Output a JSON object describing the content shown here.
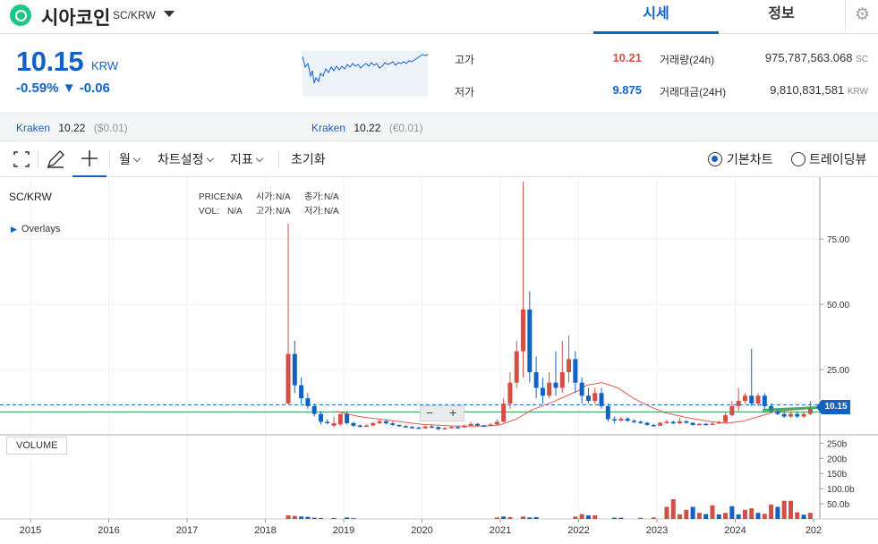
{
  "header": {
    "coin_name": "시아코인",
    "coin_pair": "SC/KRW",
    "tabs": [
      {
        "label": "시세"
      },
      {
        "label": "정보"
      }
    ]
  },
  "price": {
    "current": "10.15",
    "unit": "KRW",
    "change": "-0.59% ▼ -0.06"
  },
  "stats": {
    "high_label": "고가",
    "high_value": "10.21",
    "low_label": "저가",
    "low_value": "9.875",
    "volume_label": "거래량(24h)",
    "volume_value": "975,787,563.068",
    "volume_unit": "SC",
    "amount_label": "거래대금(24H)",
    "amount_value": "9,810,831,581",
    "amount_unit": "KRW"
  },
  "exchanges": [
    {
      "name": "Kraken",
      "price": "10.22",
      "diff": "($0.01)"
    },
    {
      "name": "Kraken",
      "price": "10.22",
      "diff": "(€0.01)"
    }
  ],
  "toolbar": {
    "period": "월",
    "chart_settings": "차트설정",
    "indicators": "지표",
    "reset": "초기화",
    "basic_chart": "기본차트",
    "trading_view": "트레이딩뷰"
  },
  "chart": {
    "pair": "SC/KRW",
    "legend": [
      [
        "PRICE:",
        "N/A",
        "시가:",
        "N/A",
        "종가:",
        "N/A"
      ],
      [
        "VOL:",
        "N/A",
        "고가:",
        "N/A",
        "저가:",
        "N/A"
      ]
    ],
    "overlays": "Overlays",
    "volume_label": "VOLUME",
    "price_tag": "10.15",
    "zoom_minus": "−",
    "zoom_plus": "+"
  },
  "colors": {
    "accent": "#1261c4",
    "up": "#d24f45",
    "down": "#1261c4",
    "ma": "#e05a4f",
    "green_line": "#2e9c52"
  },
  "chart_data": {
    "type": "candlestick",
    "title": "SC/KRW",
    "xlabels": [
      "2015",
      "2016",
      "2017",
      "2018",
      "2019",
      "2020",
      "2021",
      "2022",
      "2023",
      "2024",
      "202"
    ],
    "ylabels": [
      "75.00",
      "50.00",
      "25.00"
    ],
    "vol_ylabels": [
      "250b",
      "200b",
      "150b",
      "100.0b",
      "50.0b"
    ],
    "ylim": [
      0,
      97
    ],
    "last_price": 10.15,
    "candles": [
      [
        "2018-04",
        12,
        31,
        12,
        81,
        "up"
      ],
      [
        "2018-05",
        31,
        19,
        16,
        36,
        "down"
      ],
      [
        "2018-06",
        19,
        14,
        12,
        22,
        "down"
      ],
      [
        "2018-07",
        14,
        11,
        10,
        16,
        "down"
      ],
      [
        "2018-08",
        11,
        8,
        7,
        12,
        "down"
      ],
      [
        "2018-09",
        8,
        5,
        4,
        9,
        "down"
      ],
      [
        "2018-10",
        5,
        4.5,
        4,
        6,
        "down"
      ],
      [
        "2018-11",
        4.5,
        3.5,
        3,
        7,
        "up"
      ],
      [
        "2018-12",
        4,
        8,
        3.5,
        8,
        "up"
      ],
      [
        "2019-01",
        8,
        4.5,
        4,
        9,
        "down"
      ],
      [
        "2019-02",
        4.5,
        3.5,
        3,
        5,
        "down"
      ],
      [
        "2019-03",
        3.6,
        3.2,
        2.8,
        4,
        "down"
      ],
      [
        "2019-04",
        3.2,
        3.6,
        3,
        4,
        "up"
      ],
      [
        "2019-05",
        3.6,
        4.5,
        3.2,
        5,
        "up"
      ],
      [
        "2019-06",
        4.5,
        5.2,
        4,
        6,
        "up"
      ],
      [
        "2019-07",
        5.2,
        4.4,
        4,
        6,
        "down"
      ],
      [
        "2019-08",
        4.4,
        3.8,
        3.5,
        5,
        "down"
      ],
      [
        "2019-09",
        3.8,
        3.3,
        3,
        4,
        "down"
      ],
      [
        "2019-10",
        3.3,
        3.0,
        2.8,
        3.8,
        "down"
      ],
      [
        "2019-11",
        3.0,
        2.8,
        2.5,
        3.4,
        "down"
      ],
      [
        "2019-12",
        2.8,
        2.5,
        2.3,
        3.2,
        "down"
      ],
      [
        "2020-01",
        2.5,
        3.2,
        2.4,
        3.5,
        "up"
      ],
      [
        "2020-02",
        3.2,
        3.0,
        2.8,
        3.8,
        "down"
      ],
      [
        "2020-03",
        3.0,
        2.2,
        1.8,
        3.2,
        "down"
      ],
      [
        "2020-04",
        2.2,
        2.6,
        2,
        3,
        "up"
      ],
      [
        "2020-05",
        2.6,
        3.0,
        2.5,
        3.5,
        "up"
      ],
      [
        "2020-06",
        3.0,
        2.8,
        2.6,
        3.4,
        "down"
      ],
      [
        "2020-07",
        2.8,
        3.4,
        2.7,
        4,
        "up"
      ],
      [
        "2020-08",
        3.4,
        4.2,
        3.2,
        5,
        "up"
      ],
      [
        "2020-09",
        4.2,
        3.6,
        3.2,
        4.5,
        "down"
      ],
      [
        "2020-10",
        3.6,
        3.4,
        3.2,
        3.9,
        "down"
      ],
      [
        "2020-11",
        3.4,
        4.0,
        3.2,
        4.5,
        "up"
      ],
      [
        "2020-12",
        4.0,
        5.0,
        3.8,
        6,
        "up"
      ],
      [
        "2021-01",
        5,
        12,
        4.8,
        14,
        "up"
      ],
      [
        "2021-02",
        12,
        20,
        10,
        24,
        "up"
      ],
      [
        "2021-03",
        20,
        32,
        18,
        36,
        "up"
      ],
      [
        "2021-04",
        32,
        48,
        22,
        97,
        "up"
      ],
      [
        "2021-05",
        48,
        24,
        20,
        55,
        "down"
      ],
      [
        "2021-06",
        24,
        18,
        14,
        30,
        "down"
      ],
      [
        "2021-07",
        18,
        15,
        12,
        22,
        "down"
      ],
      [
        "2021-08",
        15,
        20,
        14,
        24,
        "up"
      ],
      [
        "2021-09",
        20,
        18,
        15,
        32,
        "down"
      ],
      [
        "2021-10",
        18,
        24,
        16,
        36,
        "up"
      ],
      [
        "2021-11",
        24,
        29,
        20,
        38,
        "up"
      ],
      [
        "2021-12",
        29,
        20,
        16,
        32,
        "down"
      ],
      [
        "2022-01",
        20,
        15,
        12,
        22,
        "down"
      ],
      [
        "2022-02",
        15,
        13,
        12,
        18,
        "down"
      ],
      [
        "2022-03",
        13,
        16,
        12,
        18,
        "up"
      ],
      [
        "2022-04",
        16,
        11,
        10,
        18,
        "down"
      ],
      [
        "2022-05",
        11,
        6,
        5,
        12,
        "down"
      ],
      [
        "2022-06",
        6,
        5.5,
        4.5,
        7,
        "down"
      ],
      [
        "2022-07",
        5.5,
        6.2,
        5,
        7,
        "up"
      ],
      [
        "2022-08",
        6.2,
        5.4,
        5,
        6.8,
        "down"
      ],
      [
        "2022-09",
        5.4,
        5.0,
        4.5,
        6,
        "down"
      ],
      [
        "2022-10",
        5.0,
        4.6,
        4.2,
        5.5,
        "down"
      ],
      [
        "2022-11",
        4.6,
        3.8,
        3.5,
        5,
        "down"
      ],
      [
        "2022-12",
        3.8,
        3.5,
        3.2,
        4.2,
        "down"
      ],
      [
        "2023-01",
        3.5,
        4.6,
        3.4,
        5,
        "up"
      ],
      [
        "2023-02",
        4.6,
        5.0,
        4.2,
        5.8,
        "up"
      ],
      [
        "2023-03",
        5.0,
        4.4,
        4,
        5.4,
        "down"
      ],
      [
        "2023-04",
        4.4,
        5.2,
        4.2,
        6.5,
        "up"
      ],
      [
        "2023-05",
        5.2,
        4.6,
        4.3,
        5.6,
        "down"
      ],
      [
        "2023-06",
        4.6,
        3.8,
        3.5,
        4.8,
        "down"
      ],
      [
        "2023-07",
        3.8,
        4.2,
        3.6,
        4.5,
        "up"
      ],
      [
        "2023-08",
        4.2,
        3.9,
        3.7,
        4.6,
        "down"
      ],
      [
        "2023-09",
        3.9,
        4.3,
        3.8,
        4.8,
        "up"
      ],
      [
        "2023-10",
        4.3,
        4.9,
        4.2,
        5.4,
        "up"
      ],
      [
        "2023-11",
        4.9,
        7.5,
        4.8,
        8.5,
        "up"
      ],
      [
        "2023-12",
        7.5,
        11,
        7,
        13,
        "up"
      ],
      [
        "2024-01",
        11,
        13,
        9,
        18,
        "up"
      ],
      [
        "2024-02",
        13,
        15,
        12,
        16,
        "up"
      ],
      [
        "2024-03",
        15,
        12,
        11,
        33,
        "down"
      ],
      [
        "2024-04",
        12,
        15,
        11,
        16,
        "up"
      ],
      [
        "2024-05",
        15,
        11,
        10,
        16,
        "down"
      ],
      [
        "2024-06",
        11,
        9,
        8.5,
        12,
        "down"
      ],
      [
        "2024-07",
        9,
        8,
        7.5,
        10,
        "down"
      ],
      [
        "2024-08",
        8,
        7,
        6.5,
        9,
        "down"
      ],
      [
        "2024-09",
        7,
        8,
        6.5,
        9,
        "up"
      ],
      [
        "2024-10",
        8,
        7,
        6.5,
        9,
        "down"
      ],
      [
        "2024-11",
        7,
        8,
        6.5,
        9,
        "up"
      ],
      [
        "2024-12",
        8,
        10.15,
        7.5,
        13,
        "up"
      ]
    ],
    "ma": [
      [
        2018.9,
        9
      ],
      [
        2019.2,
        7
      ],
      [
        2019.6,
        5.5
      ],
      [
        2020.0,
        4
      ],
      [
        2020.4,
        3.4
      ],
      [
        2020.8,
        3.4
      ],
      [
        2021.0,
        3.8
      ],
      [
        2021.2,
        6
      ],
      [
        2021.4,
        9.5
      ],
      [
        2021.7,
        13
      ],
      [
        2022.0,
        17
      ],
      [
        2022.1,
        19
      ],
      [
        2022.3,
        20
      ],
      [
        2022.5,
        18
      ],
      [
        2022.7,
        14
      ],
      [
        2022.9,
        11
      ],
      [
        2023.1,
        8.5
      ],
      [
        2023.4,
        6.5
      ],
      [
        2023.7,
        5
      ],
      [
        2023.9,
        4.5
      ],
      [
        2024.1,
        5.2
      ],
      [
        2024.3,
        7
      ],
      [
        2024.5,
        8.8
      ],
      [
        2024.7,
        9.5
      ],
      [
        2024.9,
        10
      ]
    ],
    "volumes": [
      [
        "2018-04",
        12,
        "up"
      ],
      [
        "2018-05",
        10,
        "up"
      ],
      [
        "2018-06",
        8,
        "down"
      ],
      [
        "2018-07",
        7,
        "down"
      ],
      [
        "2018-08",
        4,
        "down"
      ],
      [
        "2018-09",
        3,
        "down"
      ],
      [
        "2018-11",
        3,
        "down"
      ],
      [
        "2019-01",
        5,
        "down"
      ],
      [
        "2019-02",
        3,
        "up"
      ],
      [
        "2020-12",
        5,
        "up"
      ],
      [
        "2021-01",
        8,
        "down"
      ],
      [
        "2021-02",
        6,
        "up"
      ],
      [
        "2021-04",
        8,
        "up"
      ],
      [
        "2021-05",
        5,
        "down"
      ],
      [
        "2021-06",
        6,
        "down"
      ],
      [
        "2021-12",
        8,
        "up"
      ],
      [
        "2022-01",
        16,
        "up"
      ],
      [
        "2022-02",
        12,
        "down"
      ],
      [
        "2022-03",
        12,
        "up"
      ],
      [
        "2022-06",
        4,
        "down"
      ],
      [
        "2022-07",
        4,
        "down"
      ],
      [
        "2022-12",
        5,
        "up"
      ],
      [
        "2022-10",
        4,
        "up"
      ],
      [
        "2023-02",
        40,
        "up"
      ],
      [
        "2023-03",
        65,
        "up"
      ],
      [
        "2023-04",
        15,
        "up"
      ],
      [
        "2023-05",
        30,
        "up"
      ],
      [
        "2023-06",
        40,
        "down"
      ],
      [
        "2023-07",
        20,
        "up"
      ],
      [
        "2023-08",
        16,
        "down"
      ],
      [
        "2023-09",
        45,
        "up"
      ],
      [
        "2023-10",
        15,
        "down"
      ],
      [
        "2023-11",
        20,
        "up"
      ],
      [
        "2023-12",
        42,
        "down"
      ],
      [
        "2024-01",
        15,
        "down"
      ],
      [
        "2024-02",
        30,
        "up"
      ],
      [
        "2024-03",
        35,
        "up"
      ],
      [
        "2024-04",
        20,
        "down"
      ],
      [
        "2024-05",
        17,
        "up"
      ],
      [
        "2024-06",
        48,
        "up"
      ],
      [
        "2024-07",
        40,
        "down"
      ],
      [
        "2024-08",
        60,
        "up"
      ],
      [
        "2024-09",
        60,
        "up"
      ],
      [
        "2024-10",
        22,
        "up"
      ],
      [
        "2024-11",
        14,
        "down"
      ],
      [
        "2024-12",
        20,
        "up"
      ]
    ]
  }
}
